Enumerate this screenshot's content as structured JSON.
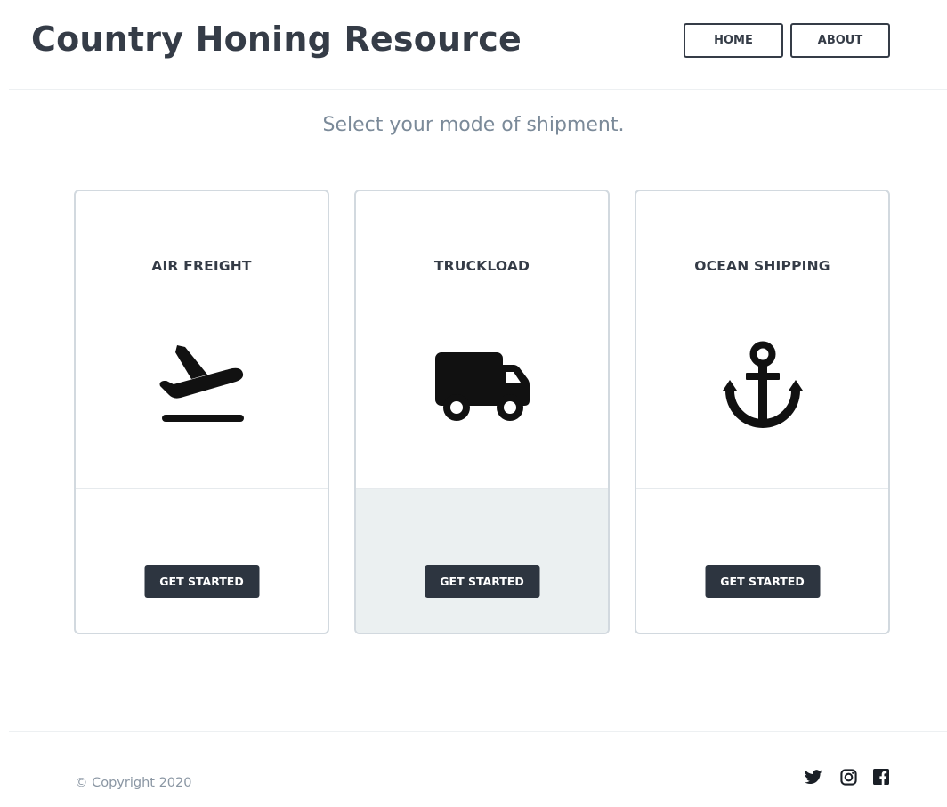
{
  "header": {
    "site_title": "Country Honing Resource",
    "nav": [
      {
        "label": "HOME"
      },
      {
        "label": "ABOUT"
      }
    ]
  },
  "main": {
    "subtitle": "Select your mode of shipment.",
    "cards": [
      {
        "title": "AIR FREIGHT",
        "icon": "airplane-takeoff-icon",
        "button_label": "GET STARTED"
      },
      {
        "title": "TRUCKLOAD",
        "icon": "truck-icon",
        "button_label": "GET STARTED"
      },
      {
        "title": "OCEAN SHIPPING",
        "icon": "anchor-icon",
        "button_label": "GET STARTED"
      }
    ]
  },
  "footer": {
    "copyright": "© Copyright 2020",
    "social_icons": [
      "twitter-icon",
      "instagram-icon",
      "facebook-icon"
    ]
  },
  "colors": {
    "text_dark": "#353c47",
    "subtitle": "#7b8a99",
    "button_bg": "#2d3540",
    "card_border": "#d2d9df",
    "hover_bg": "#ebf0f1"
  }
}
